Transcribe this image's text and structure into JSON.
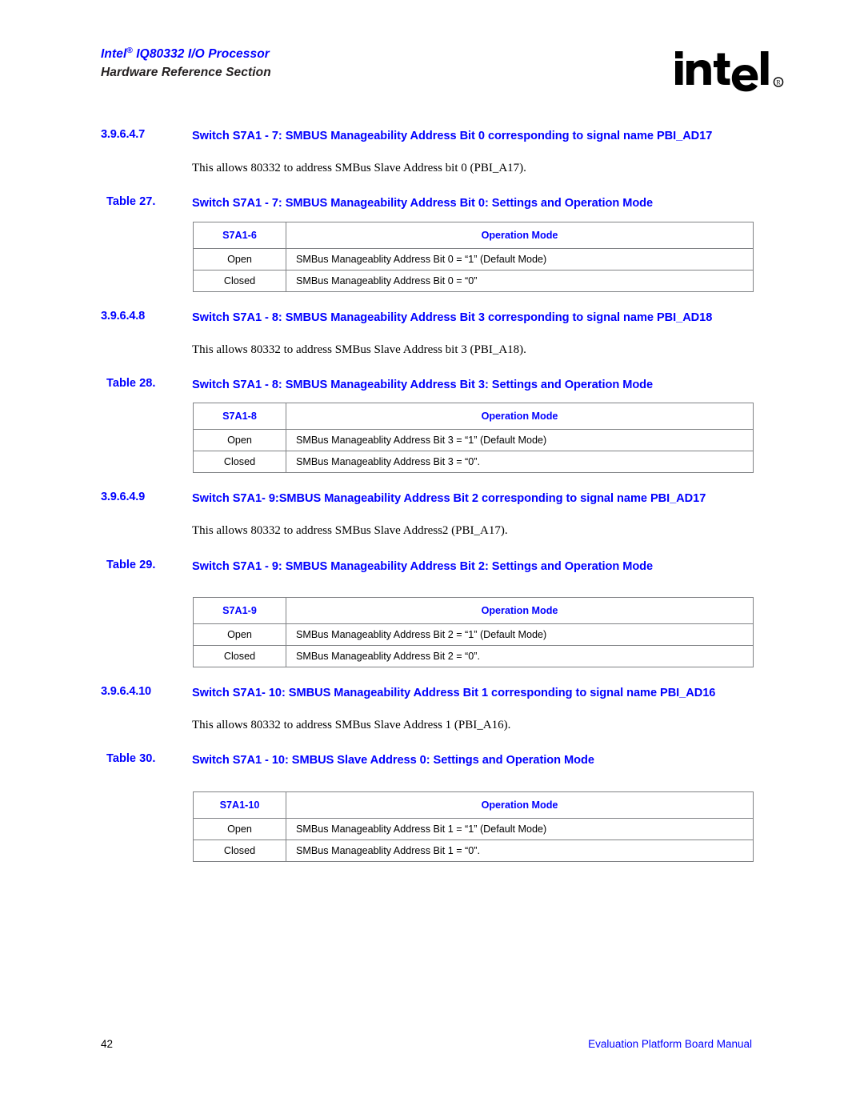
{
  "header": {
    "product_line": "Intel",
    "registered_mark": "®",
    "product_rest": " IQ80332 I/O Processor",
    "subtitle": "Hardware Reference Section",
    "logo_name": "intel-logo",
    "logo_wordmark": "intel",
    "logo_reg": "®"
  },
  "colors": {
    "accent_blue": "#0000FF",
    "heading_black": "#231F20",
    "table_outer_border": "#58585B",
    "table_inner_border": "#808285",
    "page_background": "#FFFFFF"
  },
  "sections": [
    {
      "number": "3.9.6.4.7",
      "title": "Switch S7A1 - 7: SMBUS Manageability Address Bit 0 corresponding to signal name PBI_AD17",
      "body": "This allows 80332 to address SMBus Slave Address bit 0 (PBI_A17).",
      "table": {
        "label": "Table 27.",
        "caption": "Switch S7A1 - 7: SMBUS Manageability Address Bit 0: Settings and Operation Mode",
        "headers": [
          "S7A1-6",
          "Operation Mode"
        ],
        "rows": [
          [
            "Open",
            "SMBus Manageablity Address Bit 0 = “1” (Default Mode)"
          ],
          [
            "Closed",
            "SMBus Manageablity Address Bit 0 = “0”"
          ]
        ]
      }
    },
    {
      "number": "3.9.6.4.8",
      "title": "Switch S7A1 - 8: SMBUS Manageability Address Bit 3 corresponding to signal name PBI_AD18",
      "body": "This allows 80332 to address SMBus Slave Address bit 3 (PBI_A18).",
      "table": {
        "label": "Table 28.",
        "caption": "Switch S7A1 - 8: SMBUS Manageability Address Bit 3: Settings and Operation Mode",
        "headers": [
          "S7A1-8",
          "Operation Mode"
        ],
        "rows": [
          [
            "Open",
            "SMBus Manageablity Address Bit 3 = “1” (Default Mode)"
          ],
          [
            "Closed",
            "SMBus Manageablity Address Bit 3 = “0”."
          ]
        ]
      }
    },
    {
      "number": "3.9.6.4.9",
      "title": "Switch S7A1- 9:SMBUS Manageability Address Bit 2 corresponding to signal name PBI_AD17",
      "body": "This allows 80332 to address SMBus Slave Address2 (PBI_A17).",
      "table": {
        "label": "Table 29.",
        "caption": "Switch S7A1 - 9: SMBUS Manageability Address Bit 2: Settings and Operation Mode",
        "headers": [
          "S7A1-9",
          "Operation Mode"
        ],
        "rows": [
          [
            "Open",
            "SMBus Manageablity Address Bit 2 = “1” (Default Mode)"
          ],
          [
            "Closed",
            "SMBus Manageablity Address Bit 2 = “0”."
          ]
        ]
      }
    },
    {
      "number": "3.9.6.4.10",
      "title": "Switch S7A1- 10: SMBUS Manageability Address Bit 1 corresponding to signal name PBI_AD16",
      "body": "This allows 80332 to address SMBus Slave Address 1 (PBI_A16).",
      "table": {
        "label": "Table 30.",
        "caption": "Switch S7A1 - 10: SMBUS Slave Address 0: Settings and Operation Mode",
        "headers": [
          "S7A1-10",
          "Operation Mode"
        ],
        "rows": [
          [
            "Open",
            "SMBus Manageablity Address Bit 1 = “1” (Default Mode)"
          ],
          [
            "Closed",
            "SMBus Manageablity Address Bit 1 = “0”."
          ]
        ]
      }
    }
  ],
  "footer": {
    "page_number": "42",
    "manual_title": "Evaluation Platform Board Manual"
  }
}
